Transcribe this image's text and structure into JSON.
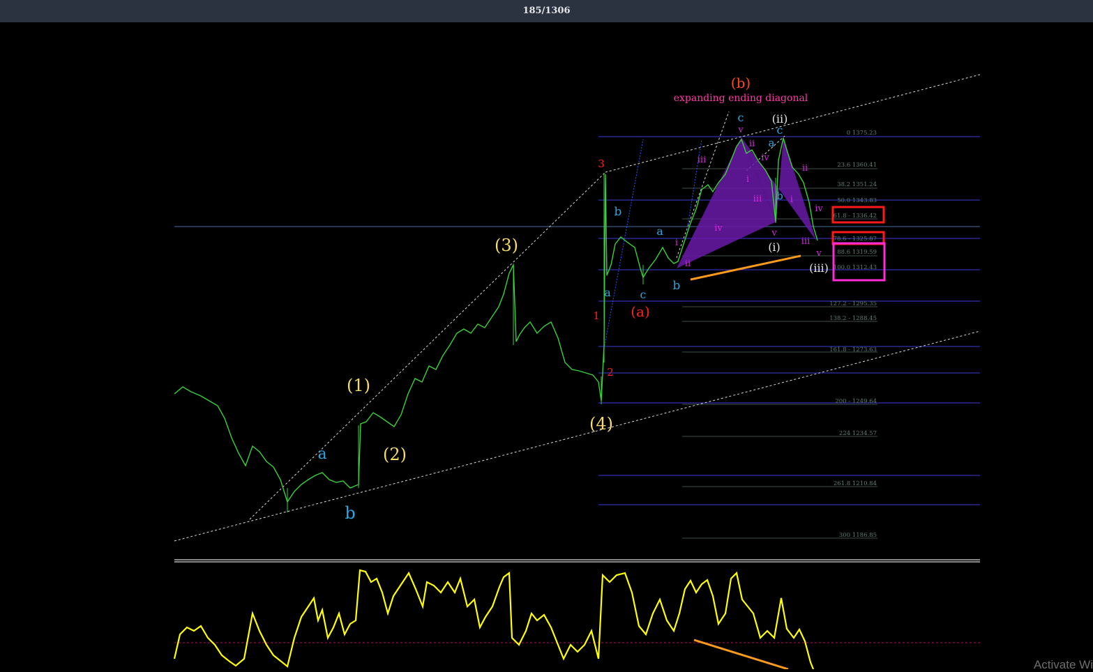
{
  "header": {
    "counter": "185/1306"
  },
  "title": "expanding ending diagonal",
  "wave_labels": {
    "w1": "(1)",
    "w2": "(2)",
    "w3": "(3)",
    "w4": "(4)",
    "a1": "a",
    "b1": "b",
    "r3": "3",
    "r1": "1",
    "r2": "2",
    "a2": "a",
    "b2": "b",
    "c2": "c",
    "wa": "(a)",
    "a3": "a",
    "b3": "b",
    "wb": "(b)",
    "c3": "c",
    "v1": "v",
    "iii1": "iii",
    "iv1": "iv",
    "i1": "i",
    "ii1": "ii",
    "iii2": "iii",
    "iv2": "iv",
    "ii2": "ii",
    "i2": "i",
    "ii3": "ii",
    "wii": "(ii)",
    "c4": "c",
    "a4": "a",
    "b4": "b",
    "v2": "v",
    "wi": "(i)",
    "iii3": "iii",
    "ii4": "ii",
    "i3": "i",
    "iv3": "iv",
    "v3": "v",
    "wiii": "(iii)"
  },
  "fib_levels": [
    "0 1375.23",
    "23.6 1360.41",
    "38.2 1351.24",
    "50.0 1343.83",
    "61.8 - 1336.42",
    "78.6 - 1325.87",
    "88.6 1319.59",
    "100.0 1312.43",
    "127.2 - 1295.35",
    "138.2 - 1288.45",
    "161.8 -  1273.63",
    "200 - 1249.64",
    "224 1234.57",
    "261.8 1210.84",
    "300 1186.85"
  ],
  "colors": {
    "candle": "#39d139",
    "oscillator": "#ffff00",
    "fib_line": "#3b3bd9",
    "fib_text": "#5e7f70",
    "wave_yellow": "#f6dd6a",
    "wave_blue": "#2aa7e6",
    "wave_red": "#ff2020",
    "wave_magenta": "#d02ad8",
    "wave_white": "#e6e6e6",
    "trend_orange": "#ff9a1a",
    "pattern_fill": "#7a1fb8"
  },
  "watermark": "Activate Wi"
}
